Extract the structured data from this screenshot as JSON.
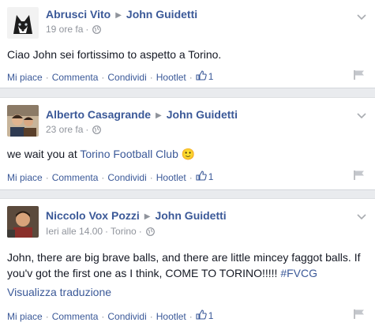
{
  "posts": [
    {
      "author": "Abrusci Vito",
      "recipient": "John Guidetti",
      "time": "19 ore fa",
      "location": "",
      "text": "Ciao John sei fortissimo to aspetto a Torino.",
      "actions": {
        "like": "Mi piace",
        "comment": "Commenta",
        "share": "Condividi",
        "hootlet": "Hootlet",
        "like_count": "1"
      }
    },
    {
      "author": "Alberto Casagrande",
      "recipient": "John Guidetti",
      "time": "23 ore fa",
      "location": "",
      "text_before": "we wait you at ",
      "text_link": "Torino Football Club",
      "emoji": "🙂",
      "actions": {
        "like": "Mi piace",
        "comment": "Commenta",
        "share": "Condividi",
        "hootlet": "Hootlet",
        "like_count": "1"
      }
    },
    {
      "author": "Niccolo Vox Pozzi",
      "recipient": "John Guidetti",
      "time": "Ieri alle 14.00",
      "location": "Torino",
      "text": "John, there are big brave balls, and there are little mincey faggot balls. If you'v got the first one as I think, COME TO TORINO!!!!! ",
      "hashtag": "#FVCG",
      "translate": "Visualizza traduzione",
      "actions": {
        "like": "Mi piace",
        "comment": "Commenta",
        "share": "Condividi",
        "hootlet": "Hootlet",
        "like_count": "1"
      }
    }
  ],
  "colors": {
    "link": "#3b5998",
    "meta": "#90949c",
    "background": "#e9ebee"
  },
  "icons": [
    "globe-icon",
    "chevron-down-icon",
    "thumbs-up-icon",
    "flag-icon"
  ]
}
